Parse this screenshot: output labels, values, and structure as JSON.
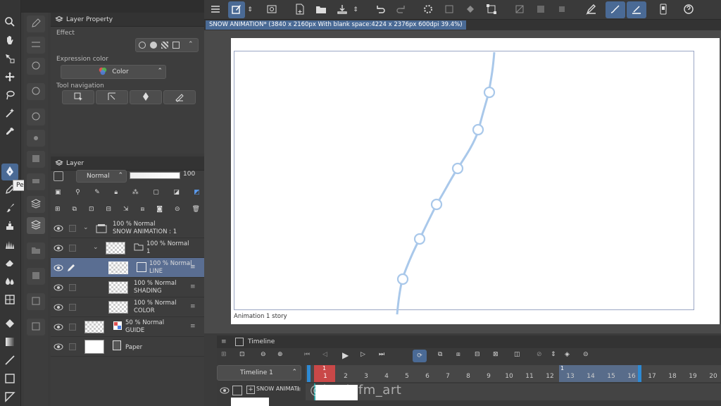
{
  "tooltip": "Pen(P)",
  "layer_property": {
    "title": "Layer Property",
    "effect_label": "Effect",
    "expression_color_label": "Expression color",
    "expression_color_value": "Color",
    "tool_navigation_label": "Tool navigation"
  },
  "layer_panel": {
    "title": "Layer",
    "blend_mode": "Normal",
    "opacity": "100",
    "layers": [
      {
        "line1": "100 % Normal",
        "line2": "SNOW ANIMATION : 1"
      },
      {
        "line1": "100 % Normal",
        "line2": "1"
      },
      {
        "line1": "100 % Normal",
        "line2": "LINE"
      },
      {
        "line1": "100 % Normal",
        "line2": "SHADING"
      },
      {
        "line1": "100 % Normal",
        "line2": "COLOR"
      },
      {
        "line1": "50 % Normal",
        "line2": "GUIDE"
      },
      {
        "line1": "",
        "line2": "Paper"
      }
    ]
  },
  "document_tab": "SNOW ANIMATION* (3840 x 2160px With blank space:4224 x 2376px 600dpi 39.4%)",
  "canvas": {
    "story_label": "Animation 1 story"
  },
  "timeline": {
    "title": "Timeline",
    "name": "Timeline 1",
    "track_label": "SNOW ANIMATI",
    "current_frame": "1",
    "marker_label": "1",
    "frame_numbers": [
      "1",
      "2",
      "3",
      "4",
      "5",
      "6",
      "7",
      "8",
      "9",
      "10",
      "11",
      "12",
      "13",
      "14",
      "15",
      "16",
      "17",
      "18",
      "19",
      "20"
    ]
  },
  "watermark": "@kevinfm_art",
  "colors": {
    "accent": "#4a6a95",
    "stroke": "#a9c8ea",
    "playhead": "#d94a4a",
    "selected_row": "#5a6e92"
  }
}
